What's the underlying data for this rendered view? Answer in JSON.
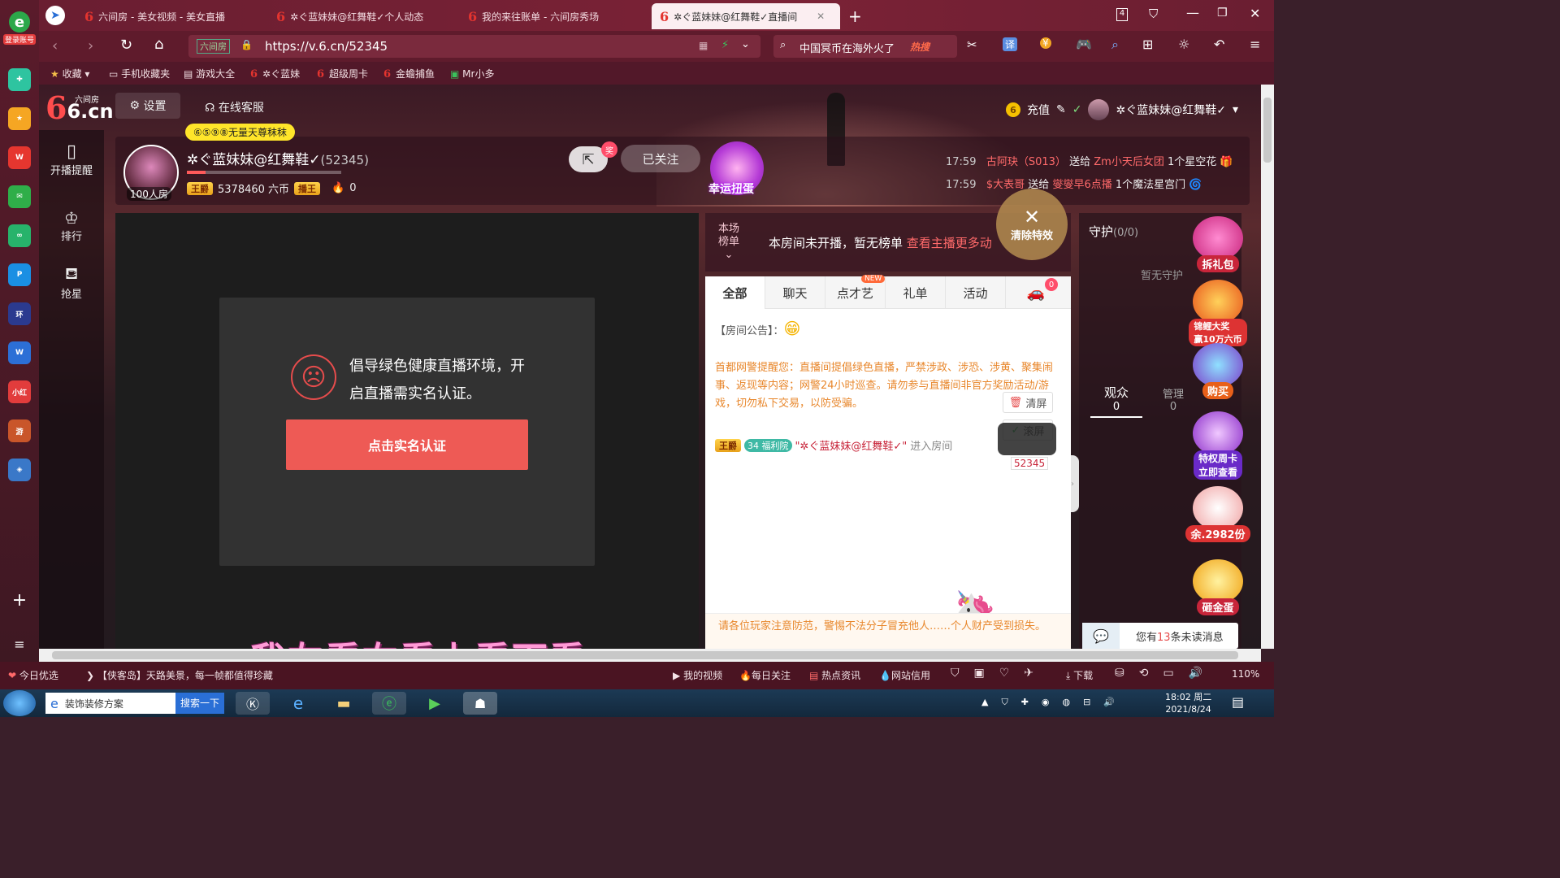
{
  "sidebar": {
    "login_label": "登录账号"
  },
  "tabs": [
    {
      "title": "六间房 - 美女视频 - 美女直播"
    },
    {
      "title": "✲ぐ蓝妹妹@红舞鞋✓个人动态"
    },
    {
      "title": "我的来往账单 - 六间房秀场"
    },
    {
      "title": "✲ぐ蓝妹妹@红舞鞋✓直播间"
    }
  ],
  "window": {
    "tab_count": "4"
  },
  "nav": {
    "url": "https://v.6.cn/52345",
    "site_badge": "六间房",
    "search_text": "中国冥币在海外火了",
    "search_hot": "热搜"
  },
  "bookmarks": [
    {
      "label": "收藏"
    },
    {
      "label": "手机收藏夹"
    },
    {
      "label": "游戏大全"
    },
    {
      "label": "✲ぐ蓝妹"
    },
    {
      "label": "超级周卡"
    },
    {
      "label": "金蟾捕鱼"
    },
    {
      "label": "Mr小多"
    }
  ],
  "site": {
    "logo_main": "6.cn",
    "logo_sub": "六间房",
    "settings": "设置",
    "service": "在线客服",
    "recharge": "充值",
    "user_name": "✲ぐ蓝妹妹@红舞鞋✓"
  },
  "leftnav": [
    {
      "label": "开播提醒"
    },
    {
      "label": "排行"
    },
    {
      "label": "抢星"
    }
  ],
  "anchor": {
    "name": "✲ぐ蓝妹妹@红舞鞋✓",
    "room_id": "(52345)",
    "room_count": "100人房",
    "tag": "⑥⑤⑨⑧无量天尊秣秣",
    "rank_badge": "王爵",
    "coins": "5378460 六币",
    "rank_badge2": "播王",
    "heat": "0",
    "follow": "已关注",
    "share_badge": "奖",
    "lucky": "幸运扭蛋"
  },
  "gifts_feed": [
    {
      "time": "17:59",
      "from": "古阿玦（S013）",
      "verb": "送给",
      "to": "Zm小天后女团",
      "item": "1个星空花"
    },
    {
      "time": "17:59",
      "from": "$大表哥",
      "verb": "送给",
      "to": "燮燮早6点播",
      "item": "1个魔法星宫门"
    }
  ],
  "video": {
    "notice_line1": "倡导绿色健康直播环境，开",
    "notice_line2": "启直播需实名认证。",
    "verify_button": "点击实名认证"
  },
  "rank": {
    "label1": "本场",
    "label2": "榜单",
    "empty_text": "本房间未开播，暂无榜单",
    "more_link": "查看主播更多动",
    "clear_effects": "清除特效"
  },
  "chat": {
    "tabs": [
      {
        "label": "全部"
      },
      {
        "label": "聊天"
      },
      {
        "label": "点才艺",
        "badge": "NEW"
      },
      {
        "label": "礼单"
      },
      {
        "label": "活动"
      }
    ],
    "car_count": "0",
    "announcement_label": "【房间公告】：",
    "police_notice": "首都网警提醒您：直播间提倡绿色直播，严禁涉政、涉恐、涉黄、聚集闹事、返现等内容；网警24小时巡查。请勿参与直播间非官方奖励活动/游戏，切勿私下交易，以防受骗。",
    "clear_screen": "清屏",
    "scroll_screen": "滚屏",
    "enter_badge": "王爵",
    "enter_level": "34",
    "enter_club": "福利院",
    "enter_user": "\"✲ぐ蓝妹妹@红舞鞋✓\"",
    "enter_text": "进入房间",
    "car_id": "52345",
    "safety_notice": "请各位玩家注意防范，警惕不法分子冒充他人……个人财产受到损失。"
  },
  "guard": {
    "label": "守护",
    "count": "(0/0)",
    "empty": "暂无守护",
    "audience_label": "观众",
    "audience_count": "0",
    "admin_label": "管理",
    "admin_count": "0",
    "unread_prefix": "您有",
    "unread_count": "13",
    "unread_suffix": "条未读消息"
  },
  "promos": [
    {
      "label": "拆礼包"
    },
    {
      "label": "锦鲤大奖",
      "sub": "赢10万六币"
    },
    {
      "label": "购买"
    },
    {
      "label": "特权周卡",
      "sub": "立即查看"
    },
    {
      "label": "余.2982份"
    },
    {
      "label": "砸金蛋"
    }
  ],
  "subtitle": "我左看右看上看下看",
  "status": {
    "today": "今日优选",
    "headline": "【侠客岛】天路美景，每一帧都值得珍藏",
    "items": [
      {
        "label": "我的视频"
      },
      {
        "label": "每日关注"
      },
      {
        "label": "热点资讯"
      },
      {
        "label": "网站信用"
      }
    ],
    "download": "下载",
    "zoom": "110%"
  },
  "taskbar": {
    "search_text": "装饰装修方案",
    "search_btn": "搜索一下",
    "time": "18:02 周二",
    "date": "2021/8/24"
  }
}
